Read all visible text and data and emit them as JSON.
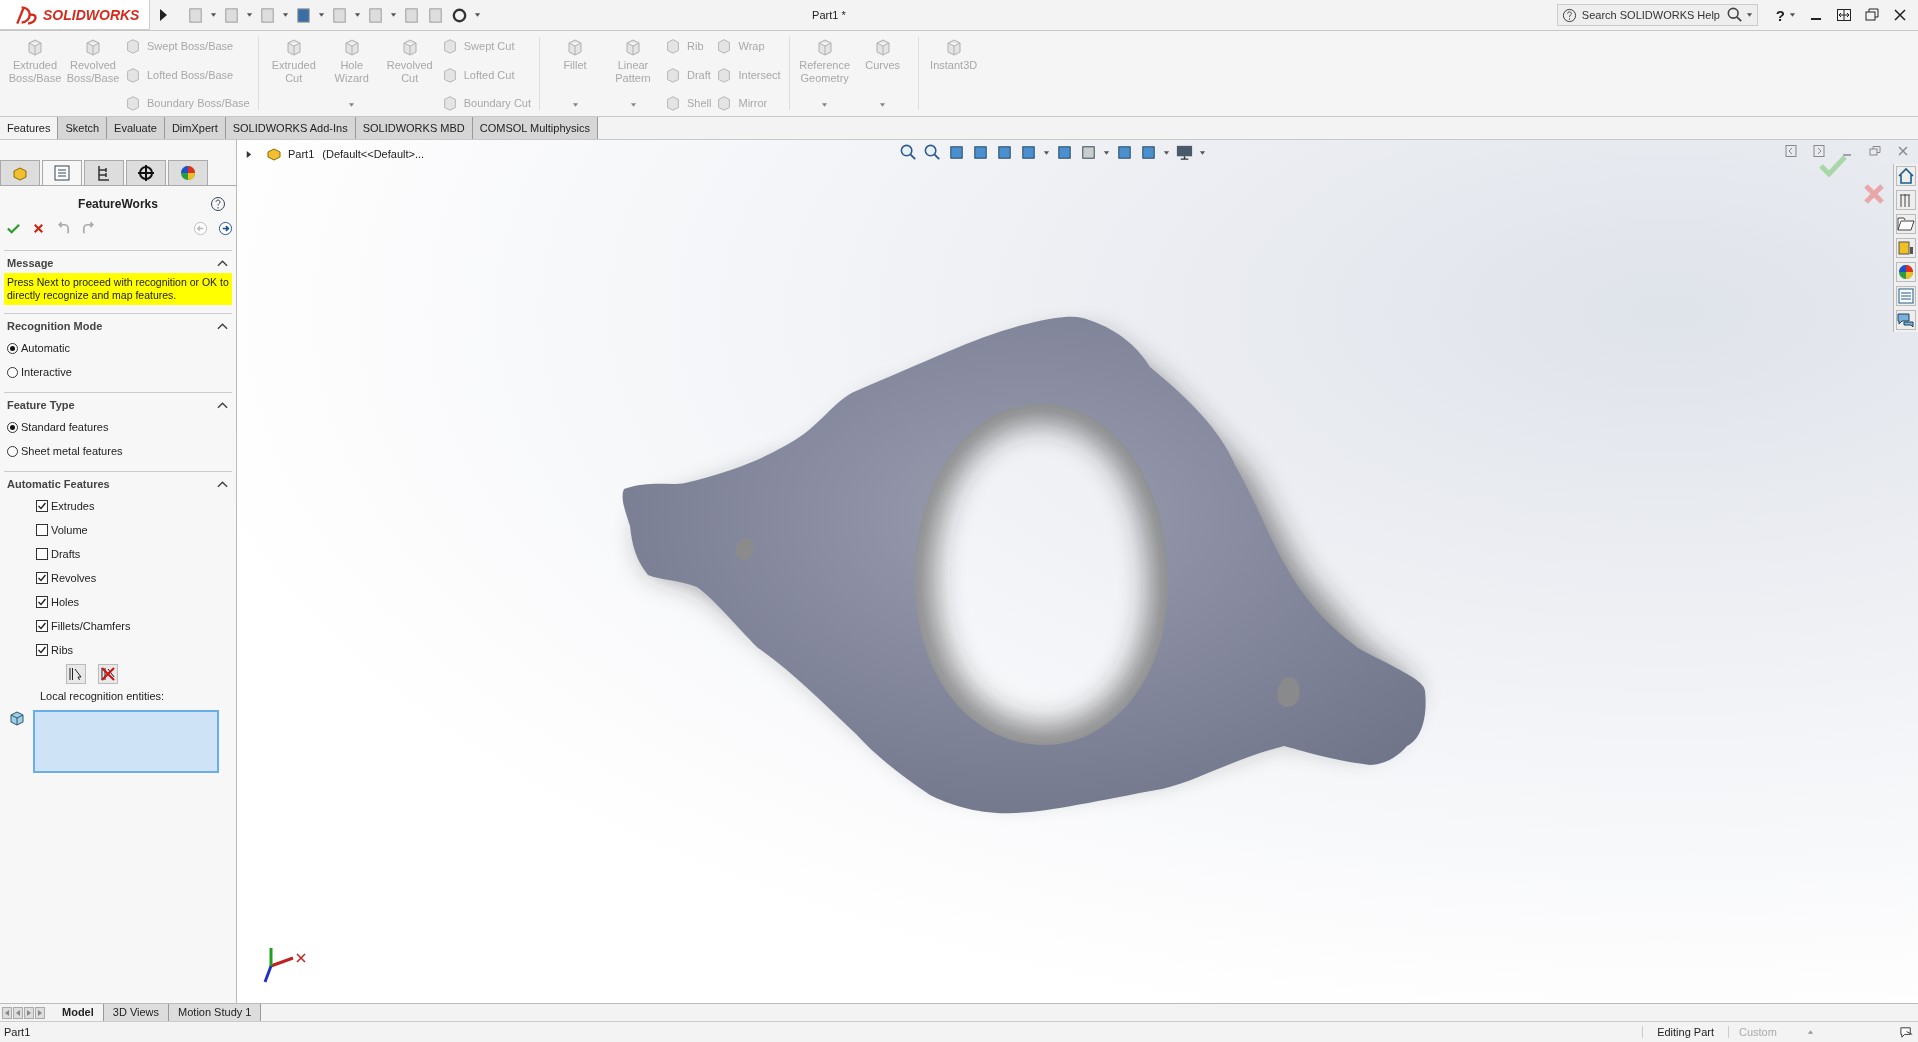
{
  "title_bar": {
    "logo": "SOLIDWORKS",
    "title": "Part1 *",
    "search": {
      "placeholder": "Search SOLIDWORKS Help"
    },
    "help": "?"
  },
  "ribbon": [
    {
      "kind": "big",
      "label": "Extruded Boss/Base",
      "dropdown": false
    },
    {
      "kind": "big",
      "label": "Revolved Boss/Base",
      "dropdown": false
    },
    {
      "kind": "stack",
      "items": [
        "Swept Boss/Base",
        "Lofted Boss/Base",
        "Boundary Boss/Base"
      ]
    },
    {
      "kind": "separator"
    },
    {
      "kind": "big",
      "label": "Extruded Cut",
      "dropdown": false
    },
    {
      "kind": "big",
      "label": "Hole Wizard",
      "dropdown": true
    },
    {
      "kind": "big",
      "label": "Revolved Cut",
      "dropdown": false
    },
    {
      "kind": "stack",
      "items": [
        "Swept Cut",
        "Lofted Cut",
        "Boundary Cut"
      ]
    },
    {
      "kind": "separator"
    },
    {
      "kind": "big",
      "label": "Fillet",
      "dropdown": true
    },
    {
      "kind": "big",
      "label": "Linear Pattern",
      "dropdown": true
    },
    {
      "kind": "stack",
      "items": [
        "Rib",
        "Draft",
        "Shell"
      ]
    },
    {
      "kind": "stack",
      "items": [
        "Wrap",
        "Intersect",
        "Mirror"
      ]
    },
    {
      "kind": "separator"
    },
    {
      "kind": "big",
      "label": "Reference Geometry",
      "dropdown": true
    },
    {
      "kind": "big",
      "label": "Curves",
      "dropdown": true
    },
    {
      "kind": "separator"
    },
    {
      "kind": "big",
      "label": "Instant3D",
      "dropdown": false
    }
  ],
  "command_tabs": [
    {
      "label": "Features",
      "selected": true
    },
    {
      "label": "Sketch",
      "selected": false
    },
    {
      "label": "Evaluate",
      "selected": false
    },
    {
      "label": "DimXpert",
      "selected": false
    },
    {
      "label": "SOLIDWORKS Add-Ins",
      "selected": false
    },
    {
      "label": "SOLIDWORKS MBD",
      "selected": false
    },
    {
      "label": "COMSOL Multiphysics",
      "selected": false
    }
  ],
  "property_manager": {
    "tabs": [
      {
        "selected": false
      },
      {
        "selected": true
      },
      {
        "selected": false
      },
      {
        "selected": false
      },
      {
        "selected": false
      }
    ],
    "title": "FeatureWorks",
    "sections": [
      {
        "kind": "message",
        "title": "Message",
        "expanded": true,
        "text": "Press Next to proceed with recognition or OK to directly recognize and map features."
      },
      {
        "kind": "radios",
        "title": "Recognition Mode",
        "expanded": true,
        "options": [
          {
            "label": "Automatic",
            "selected": true
          },
          {
            "label": "Interactive",
            "selected": false
          }
        ]
      },
      {
        "kind": "radios",
        "title": "Feature Type",
        "expanded": true,
        "options": [
          {
            "label": "Standard features",
            "selected": true
          },
          {
            "label": "Sheet metal features",
            "selected": false
          }
        ]
      },
      {
        "kind": "checks",
        "title": "Automatic Features",
        "expanded": true,
        "options": [
          {
            "label": "Extrudes",
            "checked": true
          },
          {
            "label": "Volume",
            "checked": false
          },
          {
            "label": "Drafts",
            "checked": false
          },
          {
            "label": "Revolves",
            "checked": true
          },
          {
            "label": "Holes",
            "checked": true
          },
          {
            "label": "Fillets/Chamfers",
            "checked": true
          },
          {
            "label": "Ribs",
            "checked": true
          }
        ],
        "entities_label": "Local recognition entities:"
      }
    ]
  },
  "tree": {
    "part": "Part1",
    "config": "(Default<<Default>..."
  },
  "bottom_tabs": [
    {
      "label": "Model",
      "selected": true
    },
    {
      "label": "3D Views",
      "selected": false
    },
    {
      "label": "Motion Study 1",
      "selected": false
    }
  ],
  "status_bar": {
    "left": "Part1",
    "mode": "Editing Part",
    "units": "Custom"
  }
}
